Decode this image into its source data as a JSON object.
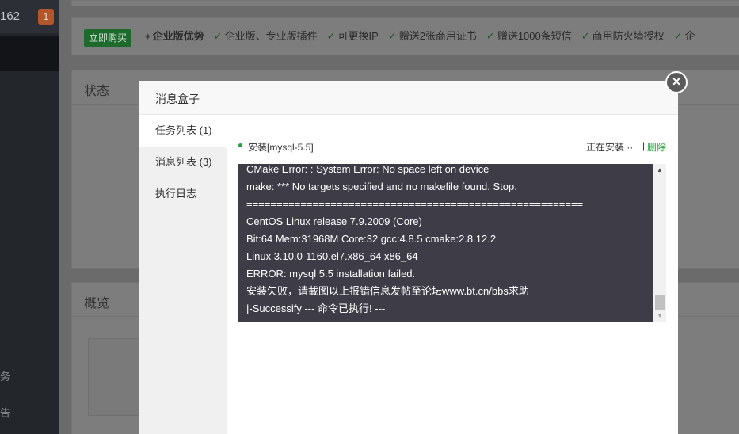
{
  "sidebar": {
    "number": "162",
    "badge": "1",
    "items": [
      {
        "label": "务"
      },
      {
        "label": "告"
      }
    ]
  },
  "features": {
    "buy_label": "立即购买",
    "enterprise_label": "企业版优势",
    "items": [
      "企业版、专业版插件",
      "可更换IP",
      "赠送2张商用证书",
      "赠送1000条短信",
      "商用防火墙授权",
      "企"
    ]
  },
  "cards": {
    "status_title": "状态",
    "overview_title": "概览"
  },
  "modal": {
    "title": "消息盒子",
    "close_icon": "×",
    "tabs": [
      {
        "label": "任务列表 (1)",
        "active": true
      },
      {
        "label": "消息列表 (3)",
        "active": false
      },
      {
        "label": "执行日志",
        "active": false
      }
    ],
    "task": {
      "name": "安装[mysql-5.5]",
      "status": "正在安装 ··",
      "separator": "|",
      "delete_label": "删除"
    },
    "console_lines": [
      "CMake Error: : System Error: No space left on device",
      "make: *** No targets specified and no makefile found.  Stop.",
      "========================================================",
      "CentOS Linux release 7.9.2009 (Core)",
      "Bit:64 Mem:31968M Core:32 gcc:4.8.5 cmake:2.8.12.2",
      "Linux 3.10.0-1160.el7.x86_64 x86_64",
      "ERROR: mysql 5.5 installation failed.",
      "安装失败，请截图以上报错信息发帖至论坛www.bt.cn/bbs求助",
      "|-Successify --- 命令已执行! ---"
    ]
  },
  "colors": {
    "accent_green": "#20a53a",
    "console_bg": "#3d3c47",
    "badge_orange": "#b5562a"
  }
}
